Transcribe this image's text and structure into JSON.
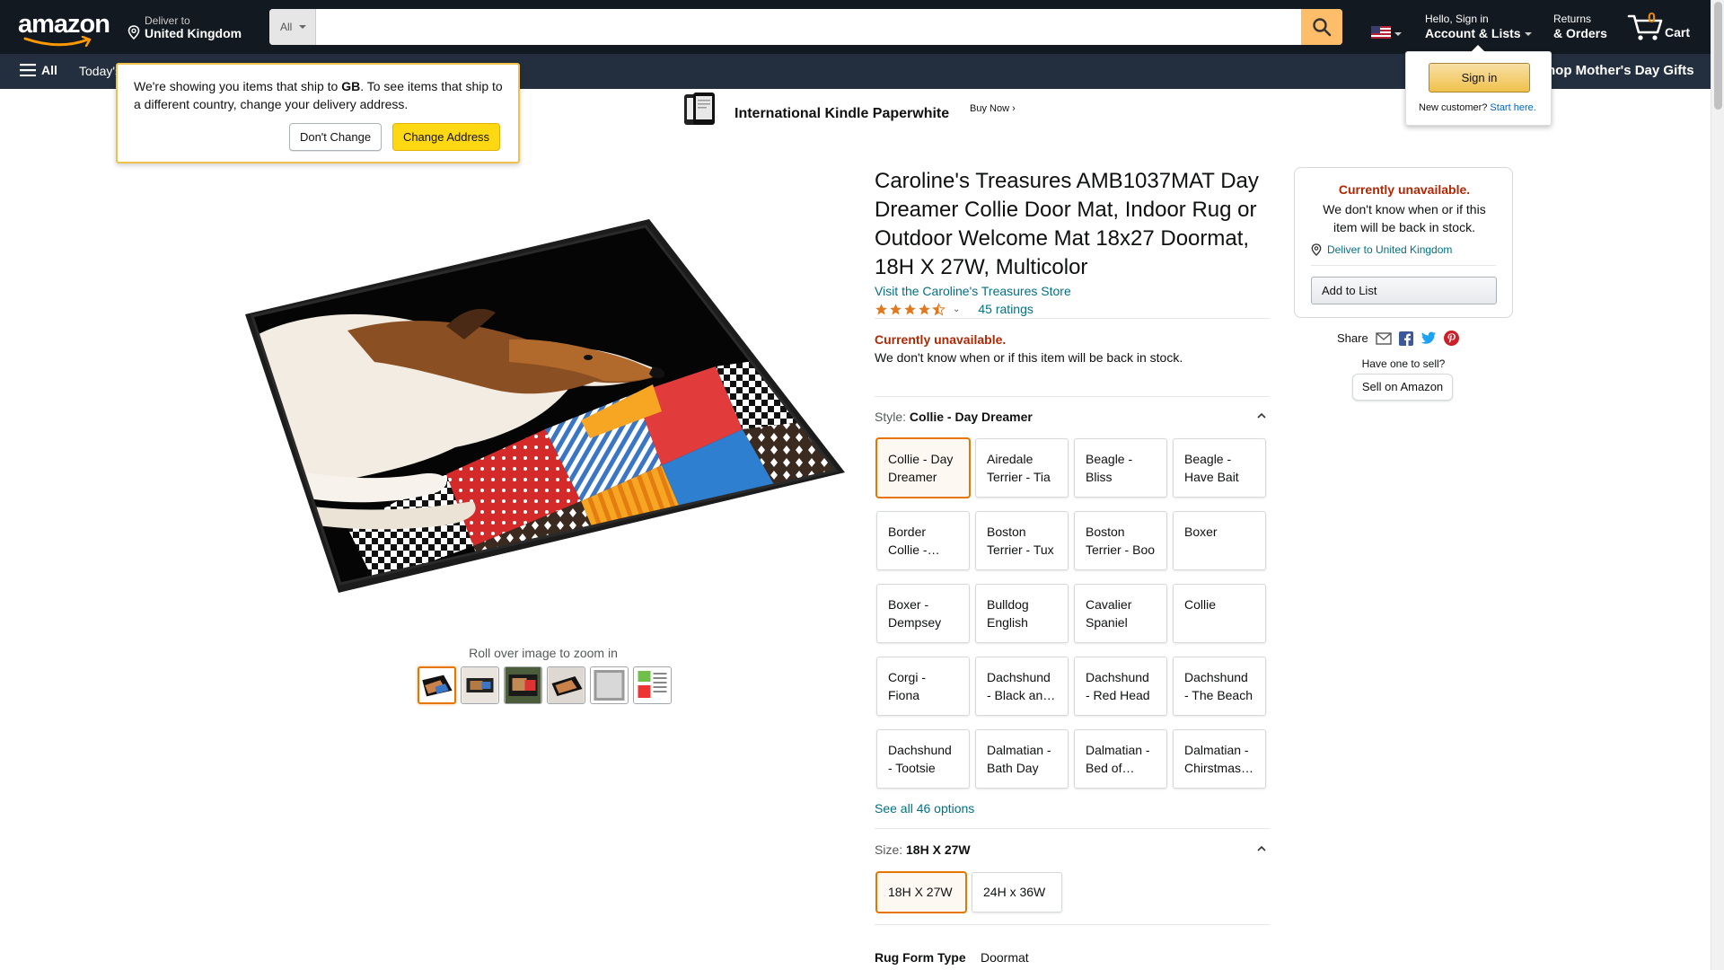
{
  "header": {
    "logo_text": "amazon",
    "deliver_small": "Deliver to",
    "deliver_country": "United Kingdom",
    "search_category": "All",
    "search_placeholder": "",
    "account_small": "Hello, Sign in",
    "account_big": "Account & Lists",
    "returns_small": "Returns",
    "returns_big": "& Orders",
    "cart_count": "0",
    "cart_label": "Cart"
  },
  "subnav": {
    "all_label": "All",
    "today_label": "Today's",
    "promo_label": "hop Mother's Day Gifts"
  },
  "banner": {
    "title": "International Kindle Paperwhite",
    "cta": "Buy Now ›"
  },
  "popover": {
    "text_before": "We're showing you items that ship to ",
    "country_code": "GB",
    "text_after": ". To see items that ship to a different country, change your delivery address.",
    "dont_change": "Don't Change",
    "change_address": "Change Address"
  },
  "signin_flyout": {
    "button": "Sign in",
    "new_customer": "New customer?",
    "start_here": "Start here."
  },
  "product": {
    "title": "Caroline's Treasures AMB1037MAT Day Dreamer Collie Door Mat, Indoor Rug or Outdoor Welcome Mat 18x27 Doormat, 18H X 27W, Multicolor",
    "store_link": "Visit the Caroline's Treasures Store",
    "rating_stars": 4.5,
    "ratings_count": "45 ratings",
    "unavailable": "Currently unavailable.",
    "unavailable_sub": "We don't know when or if this item will be back in stock.",
    "zoom_hint": "Roll over image to zoom in",
    "thumbnail_count": 6
  },
  "style": {
    "label": "Style:",
    "selected": "Collie - Day Dreamer",
    "options": [
      "Collie - Day Dreamer",
      "Airedale Terrier - Tia",
      "Beagle - Bliss",
      "Beagle - Have Bait",
      "Border Collie - Flash",
      "Boston Terrier - Tux",
      "Boston Terrier - Boo",
      "Boxer",
      "Boxer - Dempsey",
      "Bulldog English",
      "Cavalier Spaniel",
      "Collie",
      "Corgi - Fiona",
      "Dachshund - Black and Tan",
      "Dachshund - Red Head",
      "Dachshund - The Beach",
      "Dachshund - Tootsie",
      "Dalmatian - Bath Day",
      "Dalmatian - Bed of Roses",
      "Dalmatian - Chirstmas Stockings"
    ],
    "see_all": "See all 46 options"
  },
  "size": {
    "label": "Size:",
    "selected": "18H X 27W",
    "options": [
      "18H X 27W",
      "24H x 36W"
    ]
  },
  "details": {
    "rug_form_key": "Rug Form Type",
    "rug_form_value": "Doormat"
  },
  "buybox": {
    "unavailable": "Currently unavailable.",
    "sub": "We don't know when or if this item will be back in stock.",
    "deliver": "Deliver to United Kingdom",
    "add_to_list": "Add to List"
  },
  "share": {
    "label": "Share",
    "have_one": "Have one to sell?",
    "sell_button": "Sell on Amazon"
  },
  "colors": {
    "nav_dark": "#131921",
    "nav_sub": "#232f3e",
    "search_button": "#febd69",
    "link": "#007185",
    "price_red": "#b12704",
    "selected_orange": "#e77600",
    "signin_yellow": "#f0c14b"
  }
}
